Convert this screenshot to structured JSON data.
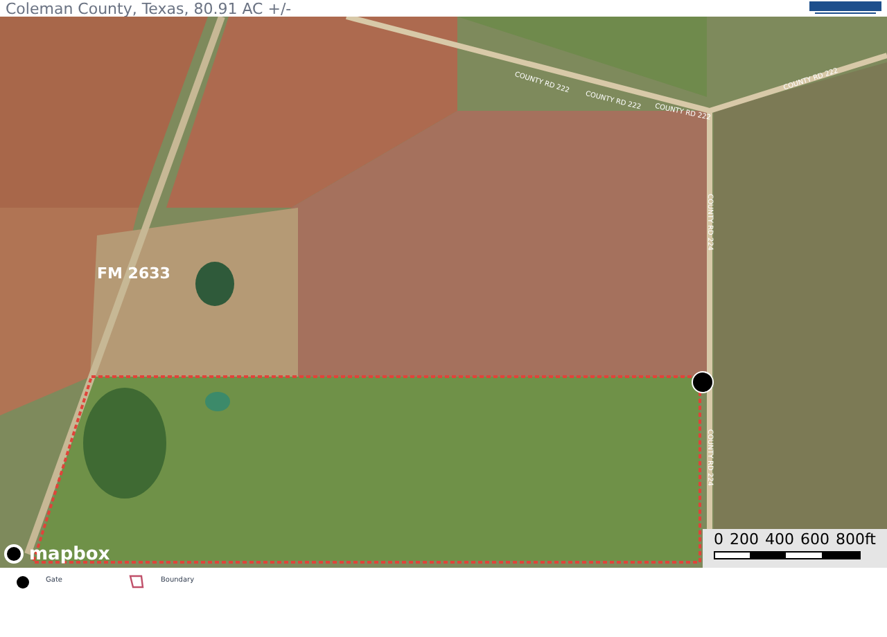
{
  "header": {
    "title": "Coleman County, Texas, 80.91 AC +/-"
  },
  "map": {
    "road_labels": [
      {
        "text": "FM 2633",
        "kind": "highway"
      },
      {
        "text": "COUNTY RD 222",
        "kind": "county"
      },
      {
        "text": "COUNTY RD 222",
        "kind": "county"
      },
      {
        "text": "COUNTY RD 222",
        "kind": "county"
      },
      {
        "text": "COUNTY RD 222",
        "kind": "county"
      },
      {
        "text": "COUNTY RD 224",
        "kind": "county"
      },
      {
        "text": "COUNTY RD 224",
        "kind": "county"
      }
    ],
    "attribution": "mapbox",
    "scale": {
      "ticks": [
        "0",
        "200",
        "400",
        "600",
        "800ft"
      ]
    }
  },
  "legend": [
    {
      "label": "Gate",
      "kind": "gate"
    },
    {
      "label": "Boundary",
      "kind": "boundary"
    }
  ]
}
